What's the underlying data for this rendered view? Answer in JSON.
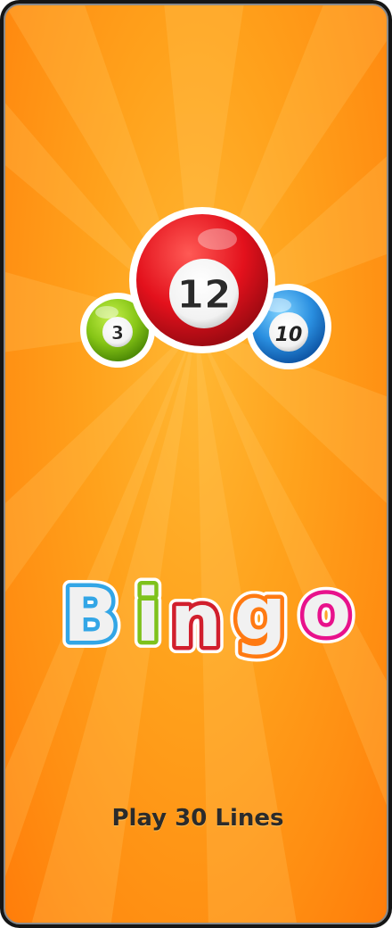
{
  "game": {
    "title": "Bingo",
    "title_letters": [
      {
        "char": "B",
        "color": "#33a6e6"
      },
      {
        "char": "i",
        "color": "#7ec21c"
      },
      {
        "char": "n",
        "color": "#d11f2d"
      },
      {
        "char": "g",
        "color": "#ff7a12"
      },
      {
        "char": "o",
        "color": "#e8128c"
      }
    ],
    "balls": {
      "green_number": "3",
      "red_number": "12",
      "blue_number": "10"
    },
    "play_button_label": "Play 30 Lines"
  }
}
